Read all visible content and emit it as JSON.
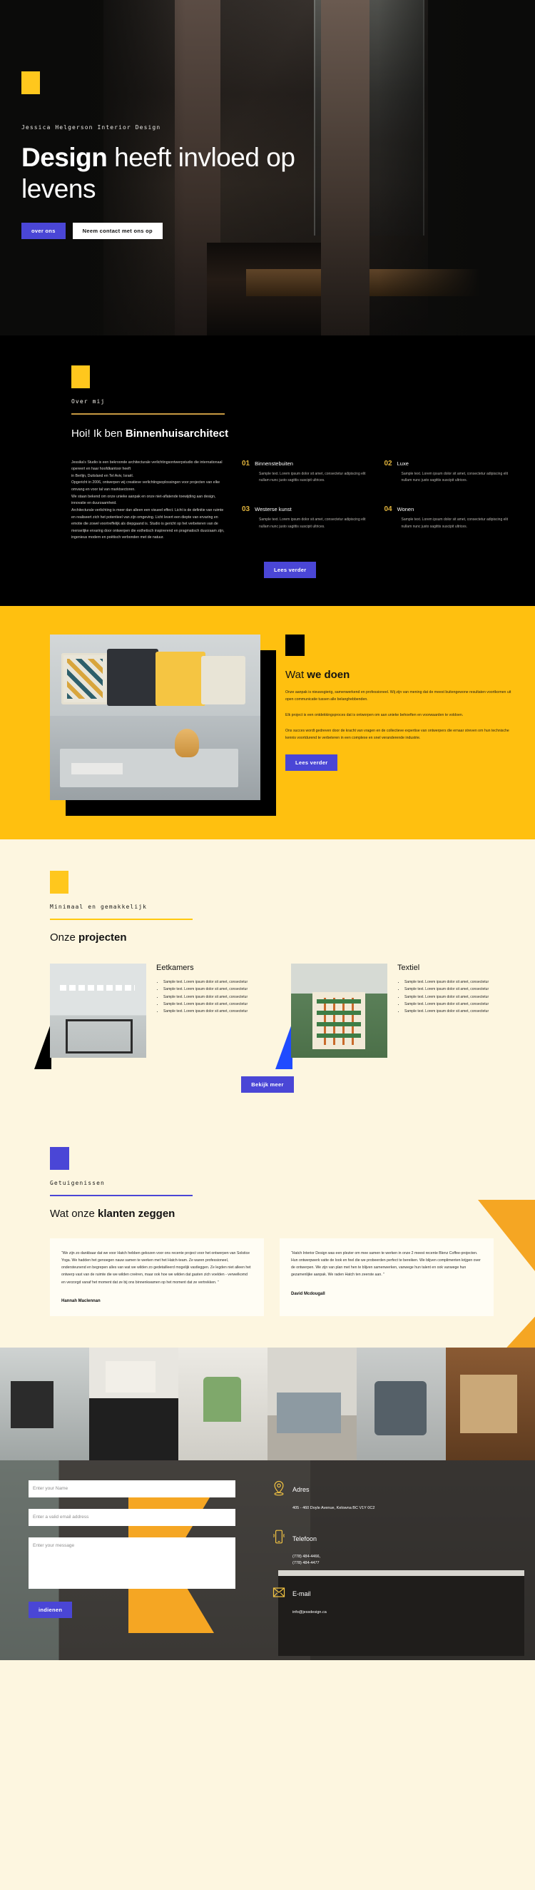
{
  "hero": {
    "eyebrow": "Jessica Helgerson Interior Design",
    "title_strong": "Design",
    "title_rest": " heeft invloed op levens",
    "btn_primary": "over ons",
    "btn_secondary": "Neem contact met ons op"
  },
  "about": {
    "eyebrow": "Over mij",
    "heading_light": "Hoi! Ik ben ",
    "heading_bold": "Binnenhuisarchitect",
    "body": "Jessika's Studio is een bekroonde architecturale verlichtingsontwerpstudio die internationaal opereert en haar hoofdkantoor heeft\nin Berlijn, Duitsland en Tel Aviv, Israël.\nOpgericht in 2006, ontwerpen wij creatieve verlichtingsoplossingen voor projecten van elke omvang en voor tal van marktsectoren.\nWe staan bekend om onze unieke aanpak en onze niet-aflatende toewijding aan design, innovatie en duurzaamheid.\nArchitecturale verlichting is meer dan alleen een visueel effect. Licht is de definitie van ruimte en realiseert zich het potentieel van zijn omgeving. Licht levert een diepte van ervaring en emotie die zowel voortreffelijk als diepgaand is. Studio is gericht op het verbeteren van de menselijke ervaring door ontwerpen die esthetisch inspirerend en pragmatisch duurzaam zijn, ingenieus modern en poëtisch verbonden met de natuur.",
    "read_more": "Lees verder",
    "features": [
      {
        "num": "01",
        "title": "Binnenstebuiten",
        "text": "Sample text. Lorem ipsum dolor sit amet, consectetur adipiscing elit nullam nunc justo sagittis suscipit ultrices."
      },
      {
        "num": "02",
        "title": "Luxe",
        "text": "Sample text. Lorem ipsum dolor sit amet, consectetur adipiscing elit nullam nunc justo sagittis suscipit ultrices."
      },
      {
        "num": "03",
        "title": "Westerse kunst",
        "text": "Sample text. Lorem ipsum dolor sit amet, consectetur adipiscing elit nullam nunc justo sagittis suscipit ultrices."
      },
      {
        "num": "04",
        "title": "Wonen",
        "text": "Sample text. Lorem ipsum dolor sit amet, consectetur adipiscing elit nullam nunc justo sagittis suscipit ultrices."
      }
    ]
  },
  "doen": {
    "heading_light": "Wat ",
    "heading_bold": "we doen",
    "body": "Onze aanpak is nieuwsgierig, samenwerkend en professioneel. Wij zijn van mening dat de meest buitengewone resultaten voortkomen uit open communicatie tussen alle belanghebbenden.\nElk project is een ontdekkingsproces dat is ontworpen om aan unieke behoeften en voorwaarden te voldoen.\nOns succes wordt gedreven door de kracht van vragen en de collectieve expertise van ontwerpers die ernaar streven om hun technische kennis voortdurend te verbeteren in een complexe en snel veranderende industrie.",
    "read_more": "Lees verder"
  },
  "projects": {
    "eyebrow": "Minimaal en gemakkelijk",
    "heading_light": "Onze ",
    "heading_bold": "projecten",
    "view_more": "Bekijk meer",
    "items": [
      {
        "title": "Eetkamers",
        "bullets": [
          "Sample text. Lorem ipsum dolor sit amet, consectetur",
          "Sample text. Lorem ipsum dolor sit amet, consectetur",
          "Sample text. Lorem ipsum dolor sit amet, consectetur",
          "Sample text. Lorem ipsum dolor sit amet, consectetur",
          "Sample text. Lorem ipsum dolor sit amet, consectetur"
        ]
      },
      {
        "title": "Textiel",
        "bullets": [
          "Sample text. Lorem ipsum dolor sit amet, consectetur",
          "Sample text. Lorem ipsum dolor sit amet, consectetur",
          "Sample text. Lorem ipsum dolor sit amet, consectetur",
          "Sample text. Lorem ipsum dolor sit amet, consectetur",
          "Sample text. Lorem ipsum dolor sit amet, consectetur"
        ]
      }
    ]
  },
  "testimonials": {
    "eyebrow": "Getuigenissen",
    "heading_light": "Wat onze ",
    "heading_bold": "klanten zeggen",
    "items": [
      {
        "quote": "“We zijn zo dankbaar dat we voor Hatch hebben gekozen voor ons recente project voor het ontwerpen van Solstice Yoga. We hadden het genoegen nauw samen te werken met het Hatch-team. Ze waren professioneel, ondersteunend en begrepen alles van wat we wilden zo gedetailleerd mogelijk vastleggen. Ze legden niet alleen het ontwerp vast van de ruimte die we wilden creëren, maar ook hoe we wilden dat gasten zich voelden - verwelkomd en verzorgd vanaf het moment dat ze bij ons binnenkwamen op het moment dat ze vertrekken. ”",
        "author": "Hannah Maclennan"
      },
      {
        "quote": "“Hatch Interior Design was een plezier om mee samen te werken in onze 2 meest recente Blenz Coffee-projecten. Hun ontwerpwerk vatte de look en feel die we probeerden perfect te bereiken. We blijven complimenten krijgen over de ontwerpen. We zijn van plan met hen te blijven samenwerken, vanwege hun talent en ook vanwege hun gezamenlijke aanpak. We raden Hatch ten zeerste aan. ”",
        "author": "David Mcdougall"
      }
    ]
  },
  "contact": {
    "name_placeholder": "Enter your Name",
    "email_placeholder": "Enter a valid email address",
    "message_placeholder": "Enter your message",
    "submit_label": "indienen",
    "blocks": [
      {
        "icon": "map-pin-icon",
        "title": "Adres",
        "text": "405 - 460 Doyle Avenue, Kelowna BC V1Y 0C2"
      },
      {
        "icon": "phone-icon",
        "title": "Telefoon",
        "text": "(778) 484-4466,\n(778) 484-4477"
      },
      {
        "icon": "envelope-icon",
        "title": "E-mail",
        "text": "info@jessdesign.ca"
      }
    ]
  },
  "colors": {
    "yellow": "#ffc00f",
    "blue": "#4a46d6",
    "orange": "#f5a623",
    "cream": "#fdf6e0",
    "black": "#000000"
  }
}
